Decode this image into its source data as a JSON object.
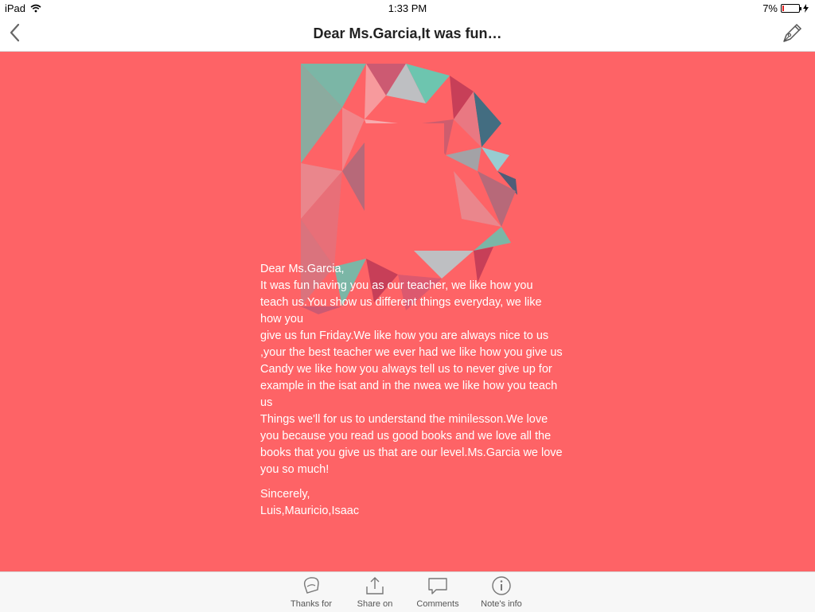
{
  "status_bar": {
    "device": "iPad",
    "time": "1:33 PM",
    "battery": "7%"
  },
  "nav": {
    "title": "Dear Ms.Garcia,It was fun…"
  },
  "logo": {
    "letter": "D",
    "colors": [
      "#6dbfae",
      "#5ed0b8",
      "#fe6366",
      "#f7a1a3",
      "#b8c9cc",
      "#2f6f84",
      "#3d5d7a",
      "#c23c57",
      "#8ed8dd"
    ]
  },
  "letter": {
    "greeting": "Dear Ms.Garcia,",
    "body": "It was fun having you as our teacher, we like how you teach us.You show us different things everyday, we like how you\ngive us fun Friday.We like how you are always nice to us ,your the best teacher we ever had we like how you give us\nCandy we like how you always tell us to never give up for example in the isat and in the nwea we like how you teach us\nThings we'll for us to understand the minilesson.We love you because you read us good books and we love all the books that you give us that are our level.Ms.Garcia we love you so much!",
    "closing": "Sincerely,",
    "signature": "Luis,Mauricio,Isaac"
  },
  "tabs": [
    {
      "label": "Thanks for",
      "icon": "thanks-icon"
    },
    {
      "label": "Share on",
      "icon": "share-icon"
    },
    {
      "label": "Comments",
      "icon": "comments-icon"
    },
    {
      "label": "Note's info",
      "icon": "info-icon"
    }
  ],
  "colors": {
    "background": "#fe6366",
    "text": "#ffffff",
    "battery_low": "#e02020"
  }
}
